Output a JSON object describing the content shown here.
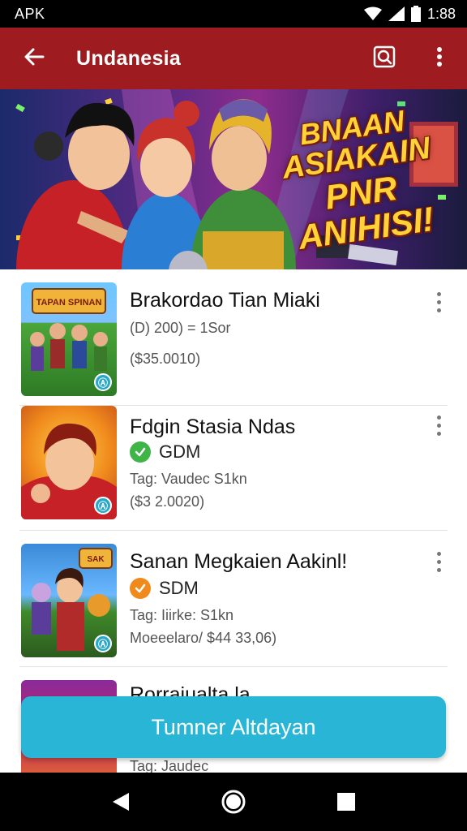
{
  "status_bar": {
    "left_text": "APK",
    "time": "1:88",
    "icons": [
      "wifi-icon",
      "signal-icon",
      "battery-icon"
    ]
  },
  "app_bar": {
    "title": "Undanesia",
    "icons": [
      "back-arrow-icon",
      "search-icon",
      "more-vert-icon"
    ]
  },
  "banner": {
    "line1": "BNAAN",
    "line2": "ASIAKAIN",
    "line3": "PNR ANIHISI!"
  },
  "items": [
    {
      "title": "Brakordao Tian Miaki",
      "line1": "(D) 200) = 1Sor",
      "line2": "($35.0010)",
      "thumb_text": "TAPAN SPINAN"
    },
    {
      "title": "Fdgin Stasia Ndas",
      "tag": "GDM",
      "tag_color": "#3fb548",
      "line1": "Tag: Vaudec S1kn",
      "line2": "($3 2.0020)"
    },
    {
      "title": "Sanan Megkaien Aakinl!",
      "tag": "SDM",
      "tag_color": "#f08a1c",
      "line1": "Tag: Iiirke: S1kn",
      "line2": "Moeeelaro/ $44 33,06)",
      "thumb_text": "SAK"
    },
    {
      "title": "Rorrajualta la",
      "line1": "Tag: Jaudec"
    }
  ],
  "cta": {
    "label": "Tumner Altdayan"
  },
  "colors": {
    "app_bar": "#9e1c1f",
    "cta": "#29b6d6"
  },
  "nav_bar": {
    "icons": [
      "nav-back-icon",
      "nav-home-icon",
      "nav-recents-icon"
    ]
  }
}
